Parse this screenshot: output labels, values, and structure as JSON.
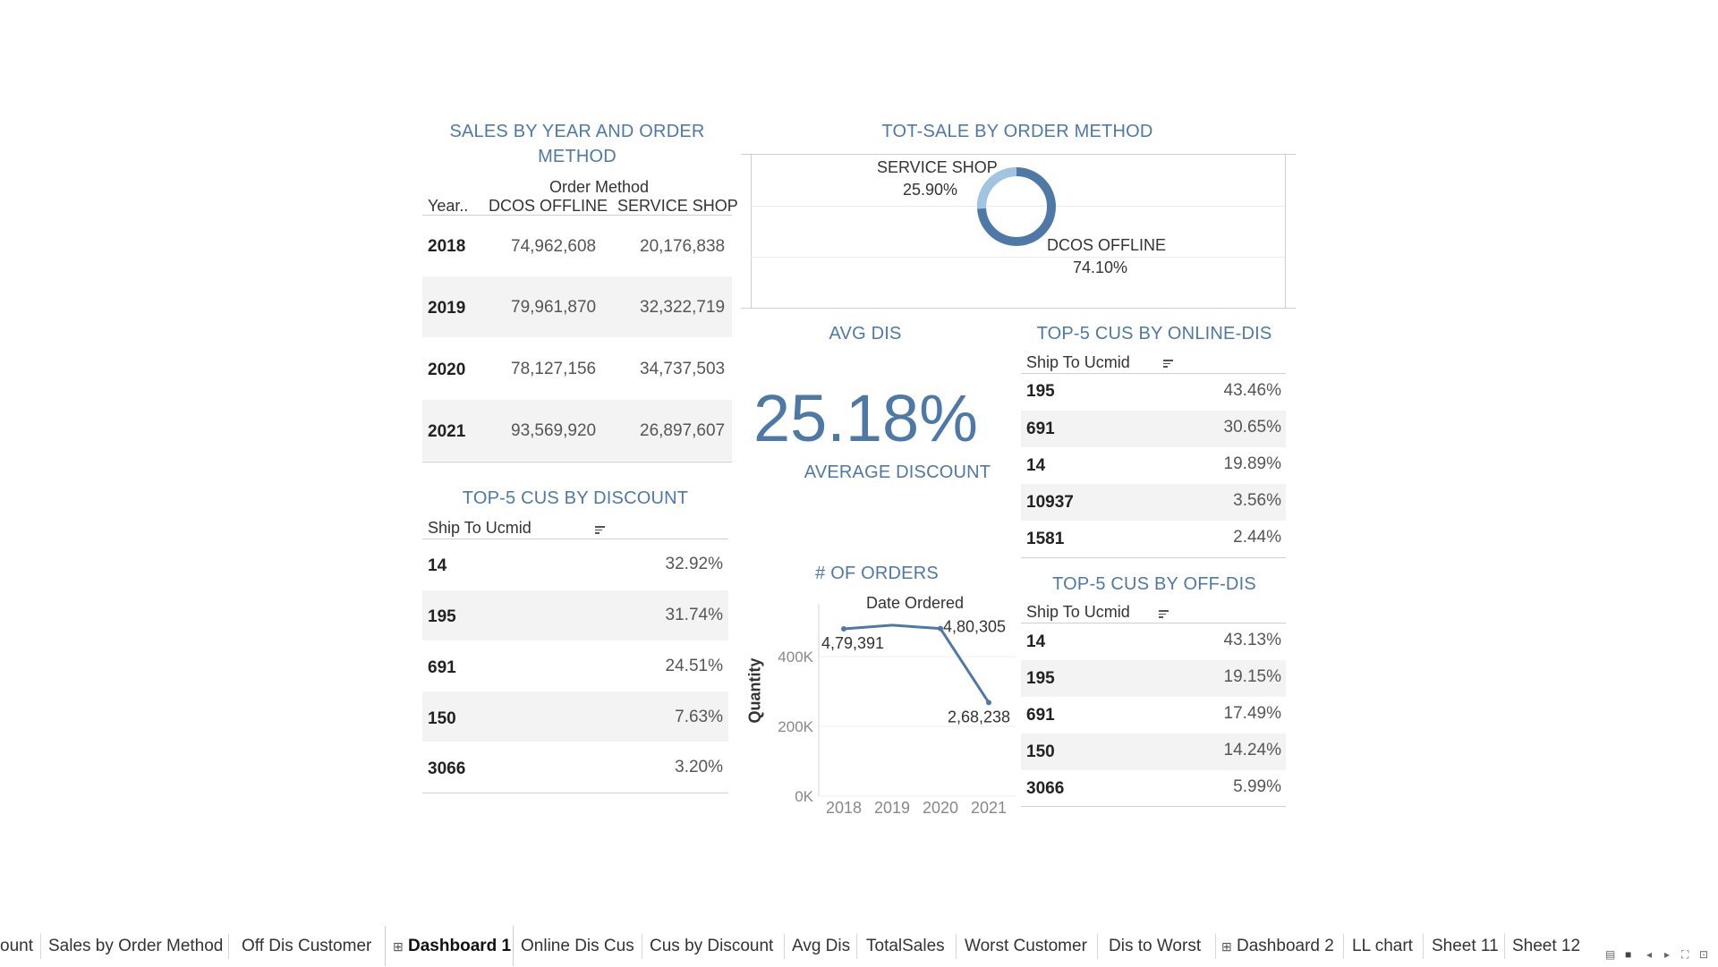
{
  "sales_table": {
    "title_line1": "SALES BY YEAR AND ORDER",
    "title_line2": "METHOD",
    "group_header": "Order Method",
    "col_year": "Year..",
    "col_a": "DCOS OFFLINE",
    "col_b": "SERVICE SHOP",
    "rows": [
      {
        "year": "2018",
        "a": "74,962,608",
        "b": "20,176,838"
      },
      {
        "year": "2019",
        "a": "79,961,870",
        "b": "32,322,719"
      },
      {
        "year": "2020",
        "a": "78,127,156",
        "b": "34,737,503"
      },
      {
        "year": "2021",
        "a": "93,569,920",
        "b": "26,897,607"
      }
    ]
  },
  "discount_table": {
    "title": "TOP-5 CUS BY DISCOUNT",
    "col": "Ship To Ucmid",
    "rows": [
      {
        "id": "14",
        "value": "32.92%"
      },
      {
        "id": "195",
        "value": "31.74%"
      },
      {
        "id": "691",
        "value": "24.51%"
      },
      {
        "id": "150",
        "value": "7.63%"
      },
      {
        "id": "3066",
        "value": "3.20%"
      }
    ]
  },
  "donut": {
    "title": "TOT-SALE BY ORDER METHOD",
    "service_label": "SERVICE SHOP",
    "service_pct": "25.90%",
    "dcos_label": "DCOS OFFLINE",
    "dcos_pct": "74.10%",
    "service_share": 25.9,
    "dcos_share": 74.1,
    "color_dark": "#4e79a7",
    "color_light": "#a0c4e2"
  },
  "avg": {
    "title": "AVG DIS",
    "value": "25.18%",
    "subtitle": "AVERAGE DISCOUNT"
  },
  "online_table": {
    "title": "TOP-5 CUS BY ONLINE-DIS",
    "col": "Ship To Ucmid",
    "rows": [
      {
        "id": "195",
        "value": "43.46%"
      },
      {
        "id": "691",
        "value": "30.65%"
      },
      {
        "id": "14",
        "value": "19.89%"
      },
      {
        "id": "10937",
        "value": "3.56%"
      },
      {
        "id": "1581",
        "value": "2.44%"
      }
    ]
  },
  "offline_table": {
    "title": "TOP-5 CUS BY OFF-DIS",
    "col": "Ship To Ucmid",
    "rows": [
      {
        "id": "14",
        "value": "43.13%"
      },
      {
        "id": "195",
        "value": "19.15%"
      },
      {
        "id": "691",
        "value": "17.49%"
      },
      {
        "id": "150",
        "value": "14.24%"
      },
      {
        "id": "3066",
        "value": "5.99%"
      }
    ]
  },
  "orders_chart": {
    "title": "# OF ORDERS",
    "subtitle": "Date Ordered",
    "ylabel": "Quantity",
    "yticks": [
      "400K",
      "200K",
      "0K"
    ],
    "xticks": [
      "2018",
      "2019",
      "2020",
      "2021"
    ],
    "labels": [
      "4,79,391",
      "4,80,305",
      "2,68,238"
    ],
    "color": "#4e79a7"
  },
  "chart_data": {
    "type": "line",
    "title": "# OF ORDERS",
    "xlabel": "Date Ordered",
    "ylabel": "Quantity",
    "x": [
      "2018",
      "2019",
      "2020",
      "2021"
    ],
    "series": [
      {
        "values": [
          479391,
          490000,
          480305,
          268238
        ]
      }
    ],
    "ylim": [
      0,
      500000
    ],
    "grid": true
  },
  "tabs": [
    "ount",
    "Sales by Order Method",
    "Off Dis Customer",
    "Dashboard 1",
    "Online Dis Cus",
    "Cus by Discount",
    "Avg Dis",
    "TotalSales",
    "Worst Customer",
    "Dis to Worst",
    "Dashboard 2",
    "LL chart",
    "Sheet 11",
    "Sheet 12"
  ]
}
